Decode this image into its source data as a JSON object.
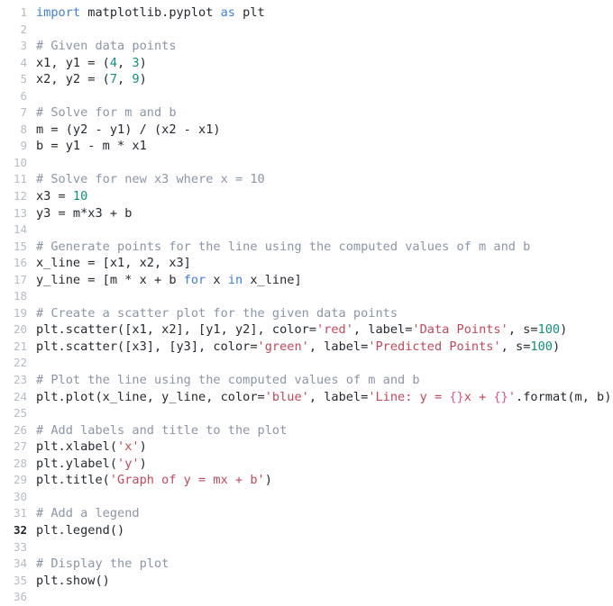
{
  "editor": {
    "language": "python",
    "background_color": "#ffffff",
    "active_line": 32,
    "total_visible_lines": 36,
    "colors": {
      "keyword": "#3f7fd6",
      "comment": "#8b95a6",
      "string": "#c2485b",
      "format_placeholder": "#e0558a",
      "number": "#0e8f7e",
      "plain_text": "#24292f",
      "gutter_text": "#b6bcc4",
      "gutter_active_text": "#1f2328"
    },
    "lines": [
      {
        "number": "1",
        "tokens": [
          {
            "t": "import",
            "c": "kw"
          },
          {
            "t": " matplotlib.pyplot ",
            "c": "plain"
          },
          {
            "t": "as",
            "c": "kw"
          },
          {
            "t": " plt",
            "c": "plain"
          }
        ]
      },
      {
        "number": "2",
        "tokens": []
      },
      {
        "number": "3",
        "tokens": [
          {
            "t": "# Given data points",
            "c": "com"
          }
        ]
      },
      {
        "number": "4",
        "tokens": [
          {
            "t": "x1, y1 = (",
            "c": "plain"
          },
          {
            "t": "4",
            "c": "num"
          },
          {
            "t": ", ",
            "c": "plain"
          },
          {
            "t": "3",
            "c": "num"
          },
          {
            "t": ")",
            "c": "plain"
          }
        ]
      },
      {
        "number": "5",
        "tokens": [
          {
            "t": "x2, y2 = (",
            "c": "plain"
          },
          {
            "t": "7",
            "c": "num"
          },
          {
            "t": ", ",
            "c": "plain"
          },
          {
            "t": "9",
            "c": "num"
          },
          {
            "t": ")",
            "c": "plain"
          }
        ]
      },
      {
        "number": "6",
        "tokens": []
      },
      {
        "number": "7",
        "tokens": [
          {
            "t": "# Solve for m and b",
            "c": "com"
          }
        ]
      },
      {
        "number": "8",
        "tokens": [
          {
            "t": "m = (y2 - y1) / (x2 - x1)",
            "c": "plain"
          }
        ]
      },
      {
        "number": "9",
        "tokens": [
          {
            "t": "b = y1 - m * x1",
            "c": "plain"
          }
        ]
      },
      {
        "number": "10",
        "tokens": []
      },
      {
        "number": "11",
        "tokens": [
          {
            "t": "# Solve for new x3 where x = 10",
            "c": "com"
          }
        ]
      },
      {
        "number": "12",
        "tokens": [
          {
            "t": "x3 = ",
            "c": "plain"
          },
          {
            "t": "10",
            "c": "num"
          }
        ]
      },
      {
        "number": "13",
        "tokens": [
          {
            "t": "y3 = m*x3 + b",
            "c": "plain"
          }
        ]
      },
      {
        "number": "14",
        "tokens": []
      },
      {
        "number": "15",
        "tokens": [
          {
            "t": "# Generate points for the line using the computed values of m and b",
            "c": "com"
          }
        ]
      },
      {
        "number": "16",
        "tokens": [
          {
            "t": "x_line = [x1, x2, x3]",
            "c": "plain"
          }
        ]
      },
      {
        "number": "17",
        "tokens": [
          {
            "t": "y_line = [m * x + b ",
            "c": "plain"
          },
          {
            "t": "for",
            "c": "kw"
          },
          {
            "t": " x ",
            "c": "plain"
          },
          {
            "t": "in",
            "c": "kw"
          },
          {
            "t": " x_line]",
            "c": "plain"
          }
        ]
      },
      {
        "number": "18",
        "tokens": []
      },
      {
        "number": "19",
        "tokens": [
          {
            "t": "# Create a scatter plot for the given data points",
            "c": "com"
          }
        ]
      },
      {
        "number": "20",
        "tokens": [
          {
            "t": "plt.scatter([x1, x2], [y1, y2], color=",
            "c": "plain"
          },
          {
            "t": "'red'",
            "c": "str"
          },
          {
            "t": ", label=",
            "c": "plain"
          },
          {
            "t": "'Data Points'",
            "c": "str"
          },
          {
            "t": ", s=",
            "c": "plain"
          },
          {
            "t": "100",
            "c": "num"
          },
          {
            "t": ")",
            "c": "plain"
          }
        ]
      },
      {
        "number": "21",
        "tokens": [
          {
            "t": "plt.scatter([x3], [y3], color=",
            "c": "plain"
          },
          {
            "t": "'green'",
            "c": "str"
          },
          {
            "t": ", label=",
            "c": "plain"
          },
          {
            "t": "'Predicted Points'",
            "c": "str"
          },
          {
            "t": ", s=",
            "c": "plain"
          },
          {
            "t": "100",
            "c": "num"
          },
          {
            "t": ")",
            "c": "plain"
          }
        ]
      },
      {
        "number": "22",
        "tokens": []
      },
      {
        "number": "23",
        "tokens": [
          {
            "t": "# Plot the line using the computed values of m and b",
            "c": "com"
          }
        ]
      },
      {
        "number": "24",
        "tokens": [
          {
            "t": "plt.plot(x_line, y_line, color=",
            "c": "plain"
          },
          {
            "t": "'blue'",
            "c": "str"
          },
          {
            "t": ", label=",
            "c": "plain"
          },
          {
            "t": "'Line: y = ",
            "c": "str"
          },
          {
            "t": "{}",
            "c": "fmt"
          },
          {
            "t": "x + ",
            "c": "str"
          },
          {
            "t": "{}",
            "c": "fmt"
          },
          {
            "t": "'",
            "c": "str"
          },
          {
            "t": ".format(m, b))",
            "c": "plain"
          }
        ]
      },
      {
        "number": "25",
        "tokens": []
      },
      {
        "number": "26",
        "tokens": [
          {
            "t": "# Add labels and title to the plot",
            "c": "com"
          }
        ]
      },
      {
        "number": "27",
        "tokens": [
          {
            "t": "plt.xlabel(",
            "c": "plain"
          },
          {
            "t": "'x'",
            "c": "str"
          },
          {
            "t": ")",
            "c": "plain"
          }
        ]
      },
      {
        "number": "28",
        "tokens": [
          {
            "t": "plt.ylabel(",
            "c": "plain"
          },
          {
            "t": "'y'",
            "c": "str"
          },
          {
            "t": ")",
            "c": "plain"
          }
        ]
      },
      {
        "number": "29",
        "tokens": [
          {
            "t": "plt.title(",
            "c": "plain"
          },
          {
            "t": "'Graph of y = mx + b'",
            "c": "str"
          },
          {
            "t": ")",
            "c": "plain"
          }
        ]
      },
      {
        "number": "30",
        "tokens": []
      },
      {
        "number": "31",
        "tokens": [
          {
            "t": "# Add a legend",
            "c": "com"
          }
        ]
      },
      {
        "number": "32",
        "active": true,
        "tokens": [
          {
            "t": "plt.legend()",
            "c": "plain"
          }
        ]
      },
      {
        "number": "33",
        "tokens": []
      },
      {
        "number": "34",
        "tokens": [
          {
            "t": "# Display the plot",
            "c": "com"
          }
        ]
      },
      {
        "number": "35",
        "tokens": [
          {
            "t": "plt.show()",
            "c": "plain"
          }
        ]
      },
      {
        "number": "36",
        "tokens": []
      }
    ]
  }
}
